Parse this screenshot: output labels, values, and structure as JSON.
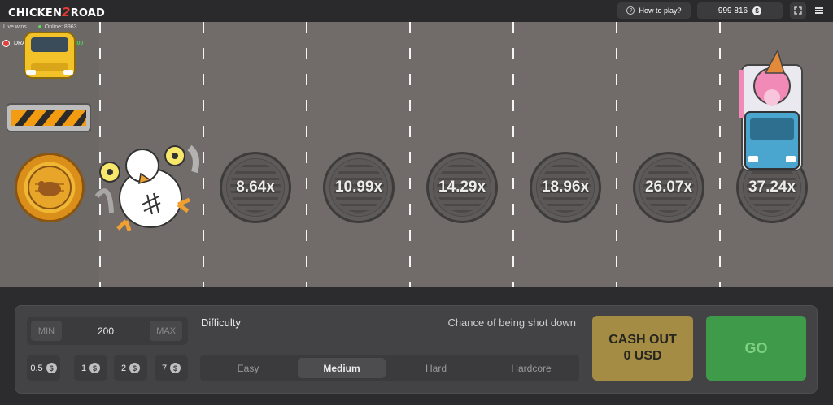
{
  "header": {
    "logo_left": "CHICKEN",
    "logo_mid": "2",
    "logo_right": "ROAD",
    "how_to_play": "How to play?",
    "balance": "999 816",
    "currency_symbol": "$"
  },
  "live": {
    "label": "Live wins",
    "online": "Online: 8963",
    "win_user": "DRAGON...",
    "win_amount": "+Ft387100.00"
  },
  "multipliers": [
    "8.64x",
    "10.99x",
    "14.29x",
    "18.96x",
    "26.07x",
    "37.24x"
  ],
  "bet": {
    "min_label": "MIN",
    "value": "200",
    "max_label": "MAX",
    "chips": [
      "0.5",
      "1",
      "2",
      "7"
    ]
  },
  "difficulty": {
    "label": "Difficulty",
    "chance_label": "Chance of being shot down",
    "options": [
      "Easy",
      "Medium",
      "Hard",
      "Hardcore"
    ],
    "selected": "Medium"
  },
  "cashout": {
    "line1": "CASH OUT",
    "line2": "0 USD"
  },
  "go_label": "GO",
  "colors": {
    "road": "#716c6a",
    "panel": "#434346",
    "cashout": "#a48c45",
    "go": "#3f9a4a",
    "win_green": "#4ed24e"
  },
  "icons": [
    "question-icon",
    "coin-icon",
    "fullscreen-icon",
    "menu-icon",
    "chicken-icon",
    "car-icon",
    "barrier-icon",
    "truck-icon",
    "coin-roast-icon"
  ]
}
